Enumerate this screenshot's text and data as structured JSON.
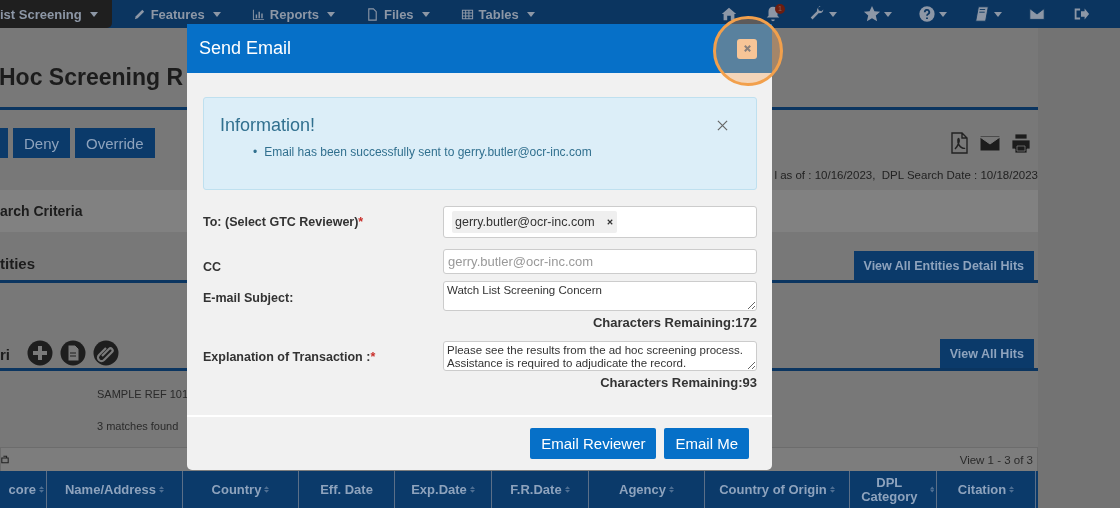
{
  "nav": {
    "items": [
      {
        "label": "ist Screening",
        "selected": true
      },
      {
        "label": "Features",
        "selected": false
      },
      {
        "label": "Reports",
        "selected": false
      },
      {
        "label": "Files",
        "selected": false
      },
      {
        "label": "Tables",
        "selected": false
      }
    ],
    "icons": [
      {
        "kind": "home",
        "dropdown": false
      },
      {
        "kind": "bell",
        "dropdown": false,
        "badge": "1"
      },
      {
        "kind": "wrench",
        "dropdown": true
      },
      {
        "kind": "star",
        "dropdown": true
      },
      {
        "kind": "help",
        "dropdown": true
      },
      {
        "kind": "book",
        "dropdown": true
      },
      {
        "kind": "envelope",
        "dropdown": false
      },
      {
        "kind": "signout",
        "dropdown": false
      }
    ]
  },
  "page": {
    "title": "Hoc Screening R",
    "actions": [
      "Deny",
      "Override"
    ],
    "export_icons": [
      {
        "kind": "pdf"
      },
      {
        "kind": "envelope"
      },
      {
        "kind": "print"
      }
    ],
    "dates": "l as of : 10/16/2023,  DPL Search Date : 10/18/2023",
    "criteria": "arch Criteria",
    "entities": {
      "title": "tities",
      "button": "View All Entities Detail Hits"
    },
    "hits": {
      "title": "ri",
      "tools": [
        {
          "kind": "plus"
        },
        {
          "kind": "document"
        },
        {
          "kind": "paperclip"
        }
      ],
      "button": "View All Hits"
    },
    "reference": "SAMPLE REF 101",
    "matches": "3 matches found",
    "pager": "View 1 - 3 of 3",
    "columns": [
      {
        "label": "core",
        "sortable": true
      },
      {
        "label": "Name/Address",
        "sortable": true
      },
      {
        "label": "Country",
        "sortable": true
      },
      {
        "label": "Eff. Date",
        "sortable": false
      },
      {
        "label": "Exp.Date",
        "sortable": true
      },
      {
        "label": "F.R.Date",
        "sortable": true
      },
      {
        "label": "Agency",
        "sortable": true
      },
      {
        "label": "Country of Origin",
        "sortable": true
      },
      {
        "label": "DPL Category",
        "sortable": true
      },
      {
        "label": "Citation",
        "sortable": true
      }
    ]
  },
  "modal": {
    "title": "Send Email",
    "close_highlighted": true,
    "alert": {
      "title": "Information!",
      "bullet": "•",
      "messages": [
        "Email has been successfully sent to gerry.butler@ocr-inc.com"
      ]
    },
    "fields": [
      {
        "kind": "chips",
        "label": "To: (Select GTC Reviewer)",
        "required_mark": "*",
        "chips": [
          "gerry.butler@ocr-inc.com"
        ]
      },
      {
        "kind": "input",
        "label": "CC",
        "placeholder": "gerry.butler@ocr-inc.com"
      },
      {
        "kind": "textarea",
        "label": "E-mail Subject:",
        "value": "Watch List Screening Concern",
        "remaining": "Characters Remaining:172"
      },
      {
        "kind": "textarea",
        "label": "Explanation of Transaction :",
        "required_mark": "*",
        "value": "Please see the results from the ad hoc screening process. Assistance is required to adjudicate the record.",
        "remaining": "Characters Remaining:93"
      }
    ],
    "buttons": [
      "Email Reviewer",
      "Email Me"
    ]
  }
}
